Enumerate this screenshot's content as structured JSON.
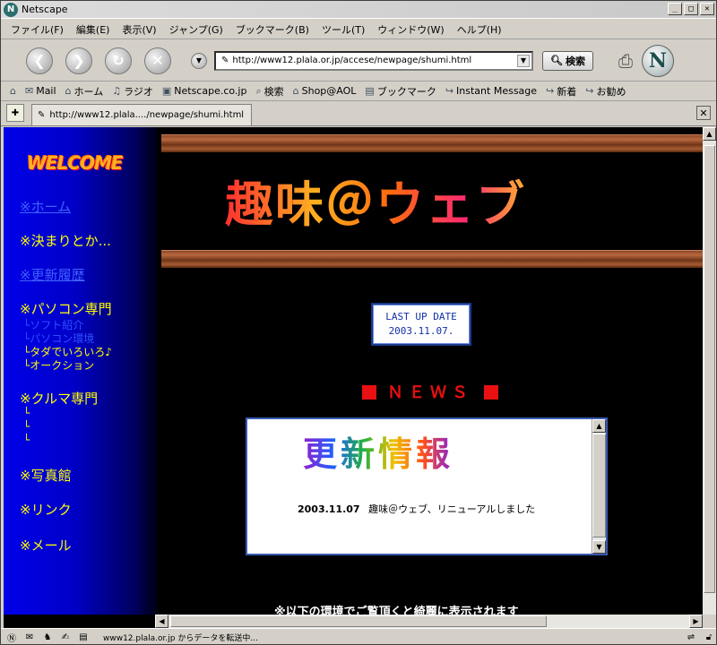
{
  "window": {
    "title": "Netscape"
  },
  "menu": [
    {
      "label": "ファイル(F)"
    },
    {
      "label": "編集(E)"
    },
    {
      "label": "表示(V)"
    },
    {
      "label": "ジャンプ(G)"
    },
    {
      "label": "ブックマーク(B)"
    },
    {
      "label": "ツール(T)"
    },
    {
      "label": "ウィンドウ(W)"
    },
    {
      "label": "ヘルプ(H)"
    }
  ],
  "navbar": {
    "url": "http://www12.plala.or.jp/accese/newpage/shumi.html",
    "search_label": "検索"
  },
  "personal_bar": [
    {
      "icon": "mail-icon",
      "label": "Mail"
    },
    {
      "icon": "home-icon",
      "label": "ホーム"
    },
    {
      "icon": "radio-icon",
      "label": "ラジオ"
    },
    {
      "icon": "my-icon",
      "label": "Netscape.co.jp"
    },
    {
      "icon": "search-icon",
      "label": "検索"
    },
    {
      "icon": "shop-icon",
      "label": "Shop@AOL"
    },
    {
      "icon": "bookmark-icon",
      "label": "ブックマーク"
    },
    {
      "icon": "link-icon",
      "label": "Instant Message"
    },
    {
      "icon": "link-icon",
      "label": "新着"
    },
    {
      "icon": "link-icon",
      "label": "お勧め"
    }
  ],
  "tab": {
    "label": "http://www12.plala..../newpage/shumi.html"
  },
  "page": {
    "welcome": "WELCOME",
    "nav": {
      "home": "※ホーム",
      "rules": "※決まりとか...",
      "history": "※更新履歴",
      "pc": "※パソコン専門",
      "pc_sub1": "└ソフト紹介",
      "pc_sub2": "└パソコン環境",
      "pc_sub3": "└タダでいろいろ♪",
      "pc_sub4": "└オークション",
      "car": "※クルマ専門",
      "car_sub1": "└",
      "car_sub2": "└",
      "car_sub3": "└",
      "photo": "※写真館",
      "link": "※リンク",
      "mail": "※メール"
    },
    "site_title": "趣味＠ウェブ",
    "last_update_label": "LAST UP DATE",
    "last_update_date": "2003.11.07.",
    "news_heading": "ＮＥＷＳ",
    "news_box_title": "更新情報",
    "news_items": [
      {
        "date": "2003.11.07",
        "text": "趣味＠ウェブ、リニューアルしました"
      }
    ],
    "footer_text": "※以下の環境でご覧頂くと綺麗に表示されます"
  },
  "status": {
    "text": "www12.plala.or.jp からデータを転送中..."
  },
  "colors": {
    "sidebar_blue": "#0000e8",
    "link_yellow": "#ffff00",
    "news_red": "#e81010"
  }
}
